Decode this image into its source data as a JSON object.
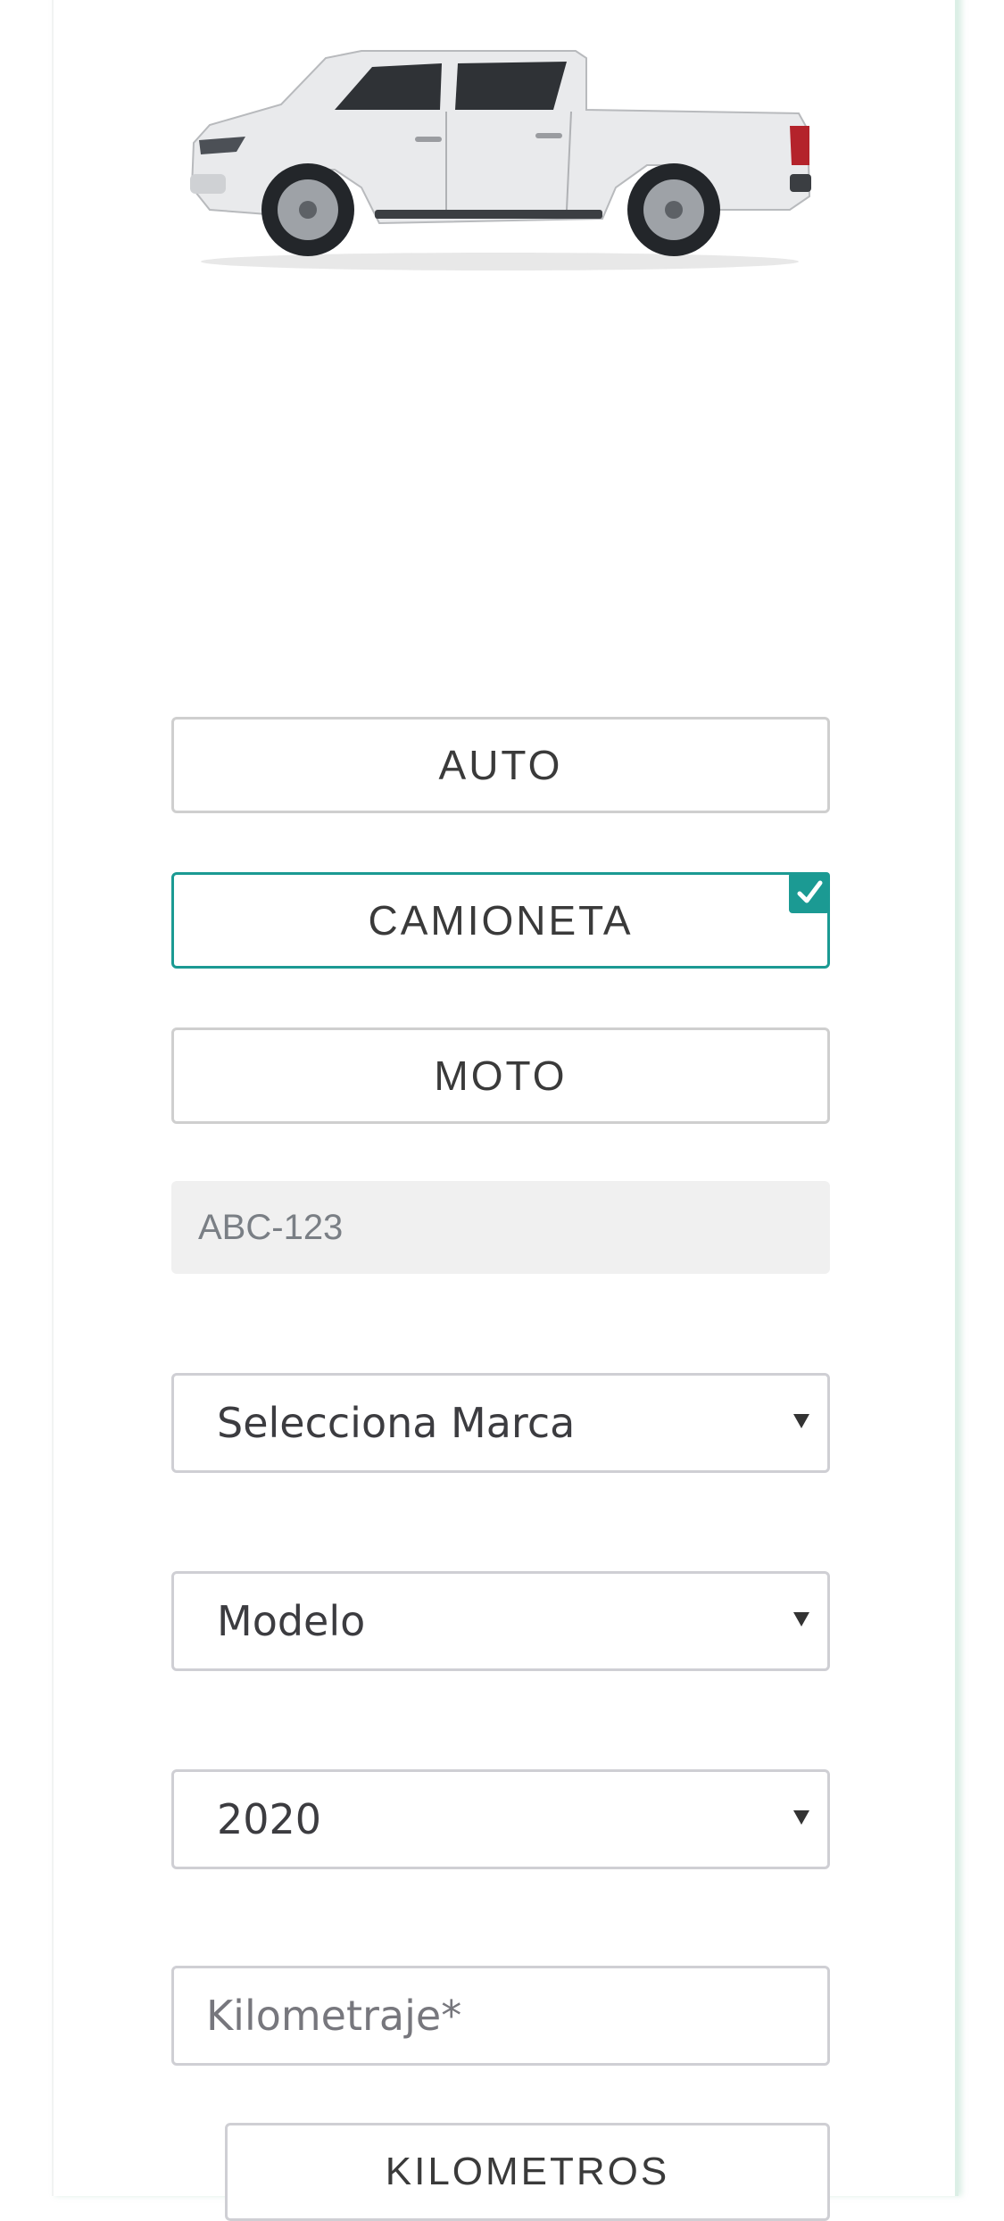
{
  "vehicle_image": {
    "alt": "Camioneta pickup blanca"
  },
  "vehicle_types": [
    {
      "label": "AUTO",
      "selected": false
    },
    {
      "label": "CAMIONETA",
      "selected": true
    },
    {
      "label": "MOTO",
      "selected": false
    }
  ],
  "plate_field": {
    "placeholder": "ABC-123",
    "value": ""
  },
  "brand_select": {
    "selected": "Selecciona Marca"
  },
  "model_select": {
    "selected": "Modelo"
  },
  "year_select": {
    "selected": "2020"
  },
  "mileage_field": {
    "placeholder": "Kilometraje*",
    "value": ""
  },
  "unit_button": {
    "label": "KILOMETROS"
  },
  "icons": {
    "selected_check": "check-icon",
    "dropdown": "caret-down-icon"
  },
  "colors": {
    "accent": "#1b9a93",
    "border": "#cfcfd4",
    "input_bg": "#f0f0f0",
    "vehicle_body": "#e9eaec"
  }
}
